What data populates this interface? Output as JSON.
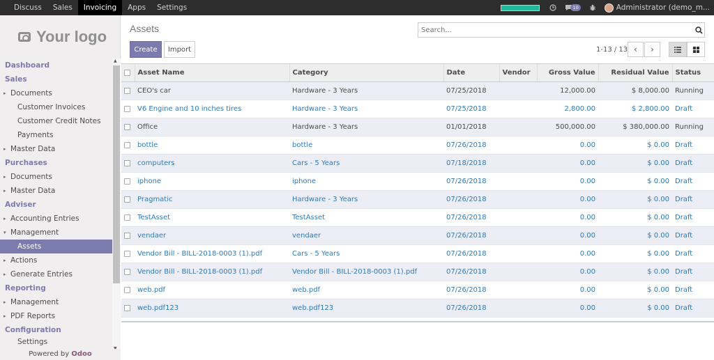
{
  "topbar": {
    "menu": [
      {
        "label": "Discuss",
        "active": false
      },
      {
        "label": "Sales",
        "active": false
      },
      {
        "label": "Invoicing",
        "active": true
      },
      {
        "label": "Apps",
        "active": false
      },
      {
        "label": "Settings",
        "active": false
      }
    ],
    "progress": 1.0,
    "messages_count": "10",
    "user": "Administrator (demo_m..."
  },
  "sidebar": {
    "logo_text": "Your logo",
    "powered_prefix": "Powered by",
    "powered_brand": "Odoo",
    "items": [
      {
        "type": "sec",
        "label": "Dashboard"
      },
      {
        "type": "sec",
        "label": "Sales"
      },
      {
        "type": "l1",
        "label": "Documents",
        "caret": "▸"
      },
      {
        "type": "l2",
        "label": "Customer Invoices"
      },
      {
        "type": "l2",
        "label": "Customer Credit Notes"
      },
      {
        "type": "l2",
        "label": "Payments"
      },
      {
        "type": "l1",
        "label": "Master Data",
        "caret": "▸"
      },
      {
        "type": "sec",
        "label": "Purchases"
      },
      {
        "type": "l1",
        "label": "Documents",
        "caret": "▸"
      },
      {
        "type": "l1",
        "label": "Master Data",
        "caret": "▸"
      },
      {
        "type": "sec",
        "label": "Adviser"
      },
      {
        "type": "l1",
        "label": "Accounting Entries",
        "caret": "▸"
      },
      {
        "type": "l1",
        "label": "Management",
        "caret": "▾"
      },
      {
        "type": "l2",
        "label": "Assets",
        "active": true
      },
      {
        "type": "l1",
        "label": "Actions",
        "caret": "▸"
      },
      {
        "type": "l1",
        "label": "Generate Entries",
        "caret": "▸"
      },
      {
        "type": "sec",
        "label": "Reporting"
      },
      {
        "type": "l1",
        "label": "Management",
        "caret": "▸"
      },
      {
        "type": "l1",
        "label": "PDF Reports",
        "caret": "▸"
      },
      {
        "type": "sec",
        "label": "Configuration"
      },
      {
        "type": "l2",
        "label": "Settings"
      }
    ]
  },
  "control": {
    "title": "Assets",
    "search_placeholder": "Search...",
    "create_label": "Create",
    "import_label": "Import",
    "pager": "1-13 / 13"
  },
  "table": {
    "columns": [
      "Asset Name",
      "Category",
      "Date",
      "Vendor",
      "Gross Value",
      "Residual Value",
      "Status"
    ],
    "rows": [
      {
        "name": "CEO's car",
        "category": "Hardware - 3 Years",
        "date": "07/25/2018",
        "vendor": "",
        "gross": "12,000.00",
        "residual": "$ 8,000.00",
        "status": "Running"
      },
      {
        "name": "V6 Engine and 10 inches tires",
        "category": "Hardware - 3 Years",
        "date": "07/25/2018",
        "vendor": "",
        "gross": "2,800.00",
        "residual": "$ 2,800.00",
        "status": "Draft"
      },
      {
        "name": "Office",
        "category": "Hardware - 3 Years",
        "date": "01/01/2018",
        "vendor": "",
        "gross": "500,000.00",
        "residual": "$ 380,000.00",
        "status": "Running"
      },
      {
        "name": "bottle",
        "category": "bottle",
        "date": "07/26/2018",
        "vendor": "",
        "gross": "0.00",
        "residual": "$ 0.00",
        "status": "Draft"
      },
      {
        "name": "computers",
        "category": "Cars - 5 Years",
        "date": "07/18/2018",
        "vendor": "",
        "gross": "0.00",
        "residual": "$ 0.00",
        "status": "Draft"
      },
      {
        "name": "iphone",
        "category": "iphone",
        "date": "07/26/2018",
        "vendor": "",
        "gross": "0.00",
        "residual": "$ 0.00",
        "status": "Draft"
      },
      {
        "name": "Pragmatic",
        "category": "Hardware - 3 Years",
        "date": "07/26/2018",
        "vendor": "",
        "gross": "0.00",
        "residual": "$ 0.00",
        "status": "Draft"
      },
      {
        "name": "TestAsset",
        "category": "TestAsset",
        "date": "07/26/2018",
        "vendor": "",
        "gross": "0.00",
        "residual": "$ 0.00",
        "status": "Draft"
      },
      {
        "name": "vendaer",
        "category": "vendaer",
        "date": "07/26/2018",
        "vendor": "",
        "gross": "0.00",
        "residual": "$ 0.00",
        "status": "Draft"
      },
      {
        "name": "Vendor Bill - BILL-2018-0003 (1).pdf",
        "category": "Cars - 5 Years",
        "date": "07/26/2018",
        "vendor": "",
        "gross": "0.00",
        "residual": "$ 0.00",
        "status": "Draft"
      },
      {
        "name": "Vendor Bill - BILL-2018-0003 (1).pdf",
        "category": "Vendor Bill - BILL-2018-0003 (1).pdf",
        "date": "07/26/2018",
        "vendor": "",
        "gross": "0.00",
        "residual": "$ 0.00",
        "status": "Draft"
      },
      {
        "name": "web.pdf",
        "category": "web.pdf",
        "date": "07/26/2018",
        "vendor": "",
        "gross": "0.00",
        "residual": "$ 0.00",
        "status": "Draft"
      },
      {
        "name": "web.pdf123",
        "category": "web.pdf123",
        "date": "07/26/2018",
        "vendor": "",
        "gross": "0.00",
        "residual": "$ 0.00",
        "status": "Draft"
      }
    ]
  },
  "colors": {
    "accent": "#7c7bad",
    "link": "#337ab7",
    "topbar": "#2d2d2d",
    "brand": "#875a7b"
  }
}
